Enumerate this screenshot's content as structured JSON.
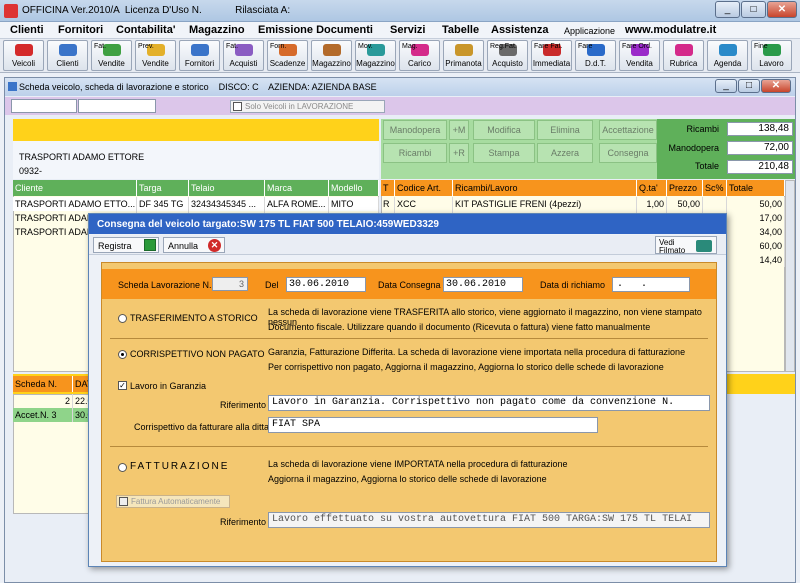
{
  "titlebar": {
    "title": "OFFICINA Ver.2010/A  Licenza D'Uso N.            Rilasciata A:"
  },
  "menu": [
    "Clienti",
    "Fornitori",
    "Contabilita'",
    "Magazzino",
    "Emissione Documenti",
    "Servizi",
    "Tabelle",
    "Assistenza"
  ],
  "menu_app": "Applicazione",
  "menu_url": "www.modulatre.it",
  "toolbar": [
    {
      "l1": "",
      "l2": "Veicoli",
      "color": "#d42a2a"
    },
    {
      "l1": "",
      "l2": "Clienti",
      "color": "#3a74c9"
    },
    {
      "l1": "Fat.",
      "l2": "Vendite",
      "color": "#3fa042"
    },
    {
      "l1": "Prev.",
      "l2": "Vendite",
      "color": "#e3b02a"
    },
    {
      "l1": "",
      "l2": "Fornitori",
      "color": "#3a74c9"
    },
    {
      "l1": "Fat.",
      "l2": "Acquisti",
      "color": "#8a5cc2"
    },
    {
      "l1": "Forn.",
      "l2": "Scadenze",
      "color": "#d66a2a"
    },
    {
      "l1": "",
      "l2": "Magazzino",
      "color": "#b36a2a"
    },
    {
      "l1": "Mov.",
      "l2": "Magazzino",
      "color": "#2a9a9a"
    },
    {
      "l1": "Mag.",
      "l2": "Carico",
      "color": "#d42a8a"
    },
    {
      "l1": "",
      "l2": "Primanota",
      "color": "#c9962a"
    },
    {
      "l1": "Reg.Fat.",
      "l2": "Acquisto",
      "color": "#6a6a6a"
    },
    {
      "l1": "Fare Fat.",
      "l2": "Immediata",
      "color": "#c92a2a"
    },
    {
      "l1": "Fare",
      "l2": "D.d.T.",
      "color": "#2a6ac9"
    },
    {
      "l1": "Fare Ord.",
      "l2": "Vendita",
      "color": "#9a2ac9"
    },
    {
      "l1": "",
      "l2": "Rubrica",
      "color": "#d42a8a"
    },
    {
      "l1": "",
      "l2": "Agenda",
      "color": "#2a8ac9"
    },
    {
      "l1": "Fine",
      "l2": "Lavoro",
      "color": "#2a9a4a"
    }
  ],
  "inner": {
    "title": "Scheda veicolo, scheda di lavorazione e storico    DISCO: C    AZIENDA: AZIENDA BASE",
    "solo_veicoli": "Solo Veicoli in LAVORAZIONE",
    "client_name": "TRASPORTI ADAMO ETTORE",
    "client_code": "0932-",
    "buttons_row1": [
      "Manodopera",
      "+M",
      "Modifica",
      "Elimina",
      "Accettazione"
    ],
    "buttons_row2": [
      "Ricambi",
      "+R",
      "Stampa",
      "Azzera",
      "Consegna"
    ],
    "totals": [
      {
        "label": "Ricambi",
        "value": "138,48"
      },
      {
        "label": "Manodopera",
        "value": "72,00"
      },
      {
        "label": "Totale",
        "value": "210,48"
      }
    ],
    "left_table": {
      "headers": [
        "Cliente",
        "Targa",
        "Telaio",
        "Marca",
        "Modello"
      ],
      "rows": [
        [
          "TRASPORTI ADAMO ETTO...",
          "DF 345 TG",
          "32434345345 ...",
          "ALFA ROME...",
          "MITO"
        ],
        [
          "TRASPORTI ADAMO",
          "",
          "",
          "",
          ""
        ],
        [
          "TRASPORTI ADAMO",
          "",
          "",
          "",
          ""
        ]
      ]
    },
    "right_table": {
      "headers": [
        "T",
        "Codice Art.",
        "Ricambi/Lavoro",
        "Q.ta'",
        "Prezzo",
        "Sc%",
        "Totale"
      ],
      "rows": [
        [
          "R",
          "XCC",
          "KIT PASTIGLIE FRENI (4pezzi)",
          "1,00",
          "50,00",
          "",
          "50,00"
        ],
        [
          "",
          "",
          "",
          "",
          "",
          "",
          "17,00"
        ],
        [
          "",
          "",
          "",
          "",
          "",
          "",
          "34,00"
        ],
        [
          "",
          "",
          "",
          "",
          "",
          "",
          "60,00"
        ],
        [
          "",
          "",
          "",
          "",
          "",
          "",
          "14,40"
        ]
      ]
    },
    "scheda_table": {
      "headers": [
        "Scheda N.",
        "DAT"
      ],
      "rows": [
        [
          "2",
          "22.0"
        ],
        [
          "Accet.N.   3",
          "30.0"
        ]
      ]
    }
  },
  "dialog": {
    "title": "Consegna del veicolo targato:SW 175 TL FIAT 500  TELAIO:459WED3329",
    "registra": "Registra",
    "annulla": "Annulla",
    "vedi": "Vedi",
    "filmato": "Filmato",
    "scheda_label": "Scheda Lavorazione N.",
    "scheda_value": "3",
    "del_label": "Del",
    "del_value": "30.06.2010",
    "consegna_label": "Data Consegna",
    "consegna_value": "30.06.2010",
    "richiamo_label": "Data di richiamo",
    "richiamo_value": ".   .",
    "opt1": {
      "label": "TRASFERIMENTO A STORICO",
      "desc1": "La scheda di lavorazione viene TRASFERITA allo storico, viene aggiornato il magazzino, non viene stampato nessun",
      "desc2": "Documento fiscale. Utilizzare quando il documento (Ricevuta o fattura) viene fatto manualmente"
    },
    "opt2": {
      "label": "CORRISPETTIVO NON PAGATO",
      "desc1": "Garanzia, Fatturazione Differita. La scheda di lavorazione viene importata nella procedura di fatturazione",
      "desc2": "Per corrispettivo non pagato, Aggiorna il magazzino, Aggiorna lo storico delle schede di lavorazione",
      "garanzia": "Lavoro in Garanzia",
      "rif_label": "Riferimento",
      "rif_value": "Lavoro in Garanzia. Corrispettivo non pagato come da convenzione N.",
      "ditta_label": "Corrispettivo da fatturare alla ditta",
      "ditta_value": "FIAT SPA"
    },
    "opt3": {
      "label": "FATTURAZIONE",
      "desc1": "La scheda di lavorazione viene IMPORTATA nella procedura di fatturazione",
      "desc2": "Aggiorna il magazzino, Aggiorna lo storico delle schede di lavorazione",
      "auto": "Fattura Automaticamente",
      "rif_label": "Riferimento",
      "rif_value": "Lavoro effettuato su vostra autovettura FIAT 500 TARGA:SW 175 TL TELAI"
    }
  }
}
